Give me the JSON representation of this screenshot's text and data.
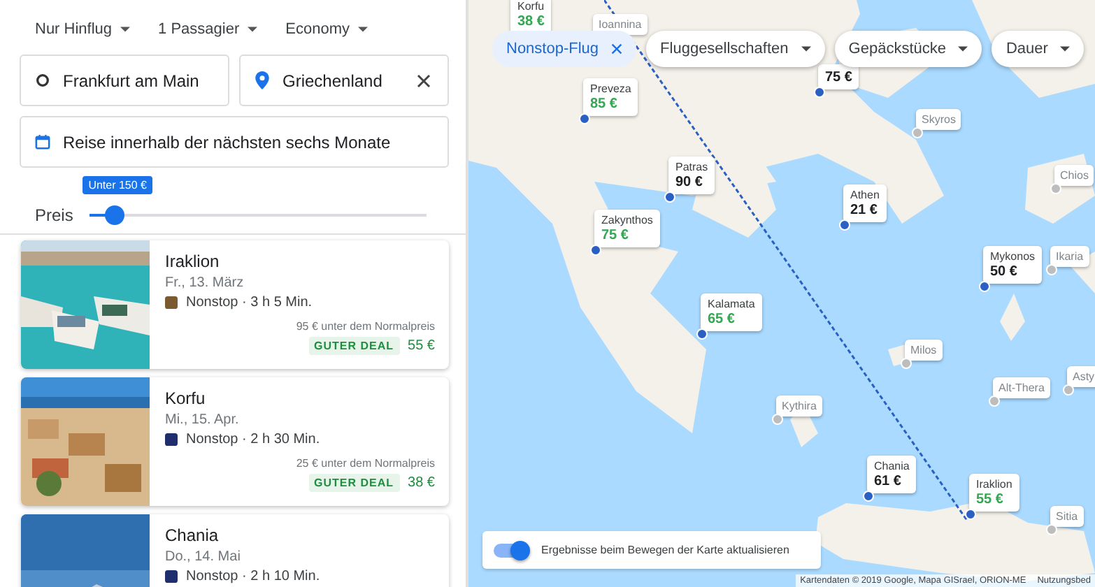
{
  "trip_options": [
    {
      "label": "Nur Hinflug"
    },
    {
      "label": "1 Passagier"
    },
    {
      "label": "Economy"
    }
  ],
  "origin": {
    "value": "Frankfurt am Main"
  },
  "destination": {
    "value": "Griechenland"
  },
  "dates": {
    "value": "Reise innerhalb der nächsten sechs Monate"
  },
  "price_filter": {
    "label": "Preis",
    "tooltip": "Unter 150 €",
    "level": 0.07
  },
  "results": [
    {
      "city": "Iraklion",
      "date": "Fr., 13. März",
      "details": "Nonstop · 3 h 5 Min.",
      "savings": "95 € unter dem Normalpreis",
      "badge": "GUTER DEAL",
      "price": "55 €",
      "deal": true,
      "color": "#7a5a2e"
    },
    {
      "city": "Korfu",
      "date": "Mi., 15. Apr.",
      "details": "Nonstop · 2 h 30 Min.",
      "savings": "25 € unter dem Normalpreis",
      "badge": "GUTER DEAL",
      "price": "38 €",
      "deal": true,
      "color": "#1f2f6e"
    },
    {
      "city": "Chania",
      "date": "Do., 14. Mai",
      "details": "Nonstop · 2 h 10 Min.",
      "color": "#1f2f6e"
    }
  ],
  "filters": [
    {
      "label": "Nonstop-Flug",
      "selected": true
    },
    {
      "label": "Fluggesellschaften",
      "selected": false
    },
    {
      "label": "Gepäckstücke",
      "selected": false
    },
    {
      "label": "Dauer",
      "selected": false
    }
  ],
  "map_pins": [
    {
      "kind": "price",
      "name": "Korfu",
      "price": "38 €",
      "deal": true
    },
    {
      "kind": "place",
      "name": "Ioannina"
    },
    {
      "kind": "price",
      "name": "Preveza",
      "price": "85 €",
      "deal": true
    },
    {
      "kind": "price",
      "price": "75 €",
      "deal": false
    },
    {
      "kind": "place",
      "name": "Skyros"
    },
    {
      "kind": "price",
      "name": "Patras",
      "price": "90 €",
      "deal": false
    },
    {
      "kind": "place",
      "name": "Chios"
    },
    {
      "kind": "price",
      "name": "Athen",
      "price": "21 €",
      "deal": false
    },
    {
      "kind": "price",
      "name": "Zakynthos",
      "price": "75 €",
      "deal": true
    },
    {
      "kind": "price",
      "name": "Mykonos",
      "price": "50 €",
      "deal": false
    },
    {
      "kind": "place",
      "name": "Ikaria"
    },
    {
      "kind": "price",
      "name": "Kalamata",
      "price": "65 €",
      "deal": true
    },
    {
      "kind": "place",
      "name": "Milos"
    },
    {
      "kind": "place",
      "name": "Alt-Thera"
    },
    {
      "kind": "place",
      "name": "Asty"
    },
    {
      "kind": "place",
      "name": "Kythira"
    },
    {
      "kind": "price",
      "name": "Chania",
      "price": "61 €",
      "deal": false
    },
    {
      "kind": "price",
      "name": "Iraklion",
      "price": "55 €",
      "deal": true
    },
    {
      "kind": "place",
      "name": "Sitia"
    }
  ],
  "map_toggle": {
    "label": "Ergebnisse beim Bewegen der Karte aktualisieren",
    "on": true
  },
  "attribution": [
    "Kartendaten © 2019 Google, Mapa GISrael, ORION-ME",
    "Nutzungsbed"
  ]
}
